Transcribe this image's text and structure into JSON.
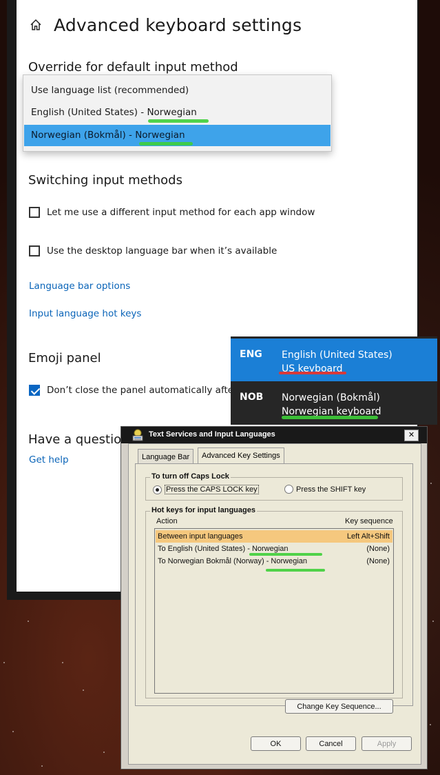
{
  "settings": {
    "title": "Advanced keyboard settings",
    "override_heading": "Override for default input method",
    "dropdown_options": [
      "Use language list (recommended)",
      "English (United States) - Norwegian",
      "Norwegian (Bokmål) - Norwegian"
    ],
    "dropdown_selected_index": 2,
    "switching_heading": "Switching input methods",
    "checkbox_app_window": "Let me use a different input method for each app window",
    "checkbox_app_window_checked": false,
    "checkbox_language_bar": "Use the desktop language bar when it’s available",
    "checkbox_language_bar_checked": false,
    "link_language_bar_options": "Language bar options",
    "link_hot_keys": "Input language hot keys",
    "emoji_heading": "Emoji panel",
    "emoji_checkbox": "Don’t close the panel automatically after",
    "emoji_checkbox_checked": true,
    "question_heading": "Have a question",
    "get_help": "Get help"
  },
  "language_flyout": {
    "items": [
      {
        "code": "ENG",
        "language": "English (United States)",
        "keyboard": "US keyboard",
        "active": true
      },
      {
        "code": "NOB",
        "language": "Norwegian (Bokmål)",
        "keyboard": "Norwegian keyboard",
        "active": false
      }
    ]
  },
  "dialog": {
    "title": "Text Services and Input Languages",
    "close_label": "✕",
    "tabs": [
      "Language Bar",
      "Advanced Key Settings"
    ],
    "active_tab_index": 1,
    "caps_lock_group": "To turn off Caps Lock",
    "caps_option_1": "Press the CAPS LOCK key",
    "caps_option_2": "Press the SHIFT key",
    "caps_selected": 1,
    "hotkeys_group": "Hot keys for input languages",
    "col_action": "Action",
    "col_sequence": "Key sequence",
    "rows": [
      {
        "action": "Between input languages",
        "sequence": "Left Alt+Shift",
        "selected": true
      },
      {
        "action": "To English (United States) - Norwegian",
        "sequence": "(None)",
        "selected": false
      },
      {
        "action": "To Norwegian Bokmål (Norway) - Norwegian",
        "sequence": "(None)",
        "selected": false
      }
    ],
    "change_key_sequence": "Change Key Sequence...",
    "ok": "OK",
    "cancel": "Cancel",
    "apply": "Apply"
  },
  "colors": {
    "accent_blue": "#1b7fd6",
    "dropdown_selection": "#3ea3ea",
    "highlight_green": "#3fcf3a",
    "highlight_red": "#d83a3a",
    "list_selection": "#f5c87e"
  }
}
